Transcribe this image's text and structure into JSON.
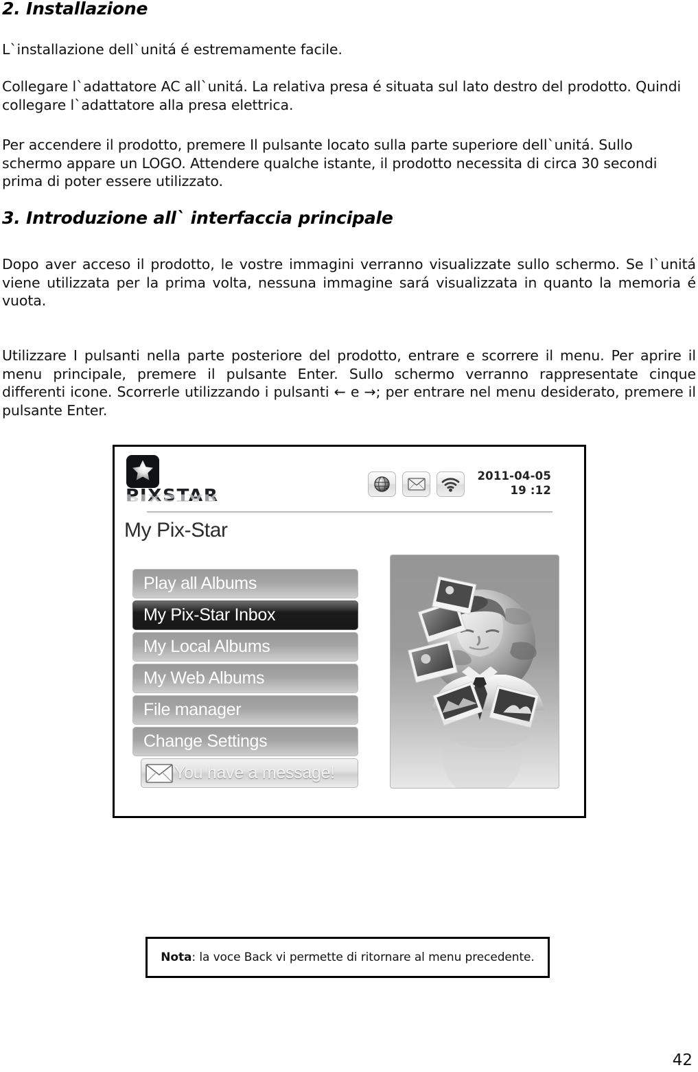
{
  "document": {
    "page_number": "42",
    "sections": [
      {
        "heading": "2. Installazione",
        "paragraphs": [
          "L`installazione dell`unitá é estremamente facile.",
          "Collegare l`adattatore AC all`unitá. La relativa presa é situata sul lato destro del prodotto. Quindi collegare l`adattatore alla presa elettrica.",
          "Per accendere il prodotto, premere Il pulsante locato sulla parte superiore dell`unitá. Sullo schermo appare un LOGO. Attendere qualche istante, il prodotto necessita di circa 30 secondi prima di poter essere utilizzato."
        ]
      },
      {
        "heading": "3. Introduzione all` interfaccia principale",
        "paragraphs": [
          "Dopo aver acceso il prodotto, le vostre immagini verranno visualizzate sullo schermo. Se l`unitá viene utilizzata per la prima volta, nessuna immagine sará visualizzata in quanto la memoria é vuota.",
          "Utilizzare I pulsanti nella parte posteriore del prodotto, entrare e scorrere il menu. Per aprire il menu principale, premere il pulsante Enter. Sullo schermo verranno rappresentate cinque differenti icone. Scorrerle utilizzando i pulsanti ← e →; per entrare nel menu desiderato, premere il pulsante Enter."
        ]
      }
    ],
    "note": {
      "label": "Nota",
      "separator": ": ",
      "text": "la voce Back vi permette di ritornare al menu precedente."
    }
  },
  "figure": {
    "device_screen": {
      "brand": {
        "wordmark_pix": "PIX",
        "wordmark_star": "STAR",
        "wordmark_full": "PIXSTAR",
        "star_icon": "star-icon"
      },
      "status_icons": [
        {
          "name": "globe-icon",
          "label": "Internet"
        },
        {
          "name": "mail-icon",
          "label": "Mail"
        },
        {
          "name": "wifi-icon",
          "label": "Wi-Fi"
        }
      ],
      "date": "2011-04-05",
      "time": "19 :12",
      "title": "My Pix-Star",
      "menu_items": [
        {
          "label": "Play all Albums",
          "selected": false,
          "icon": null
        },
        {
          "label": "My Pix-Star Inbox",
          "selected": true,
          "icon": null
        },
        {
          "label": "My Local Albums",
          "selected": false,
          "icon": null
        },
        {
          "label": "My Web Albums",
          "selected": false,
          "icon": null
        },
        {
          "label": "File manager",
          "selected": false,
          "icon": null
        },
        {
          "label": "Change Settings",
          "selected": false,
          "icon": null
        },
        {
          "label": "You have a message!",
          "selected": false,
          "icon": "mail-icon"
        }
      ],
      "artwork": {
        "name": "globe-person-photos-illustration",
        "description": "Grayscale illustration of a person in front of a globe with floating photo prints"
      },
      "colors": {
        "button_light": "#a4a4a4",
        "button_selected": "#1a1a1a",
        "panel_bg": "#9b9b9b",
        "text_light": "#ffffff"
      }
    }
  }
}
